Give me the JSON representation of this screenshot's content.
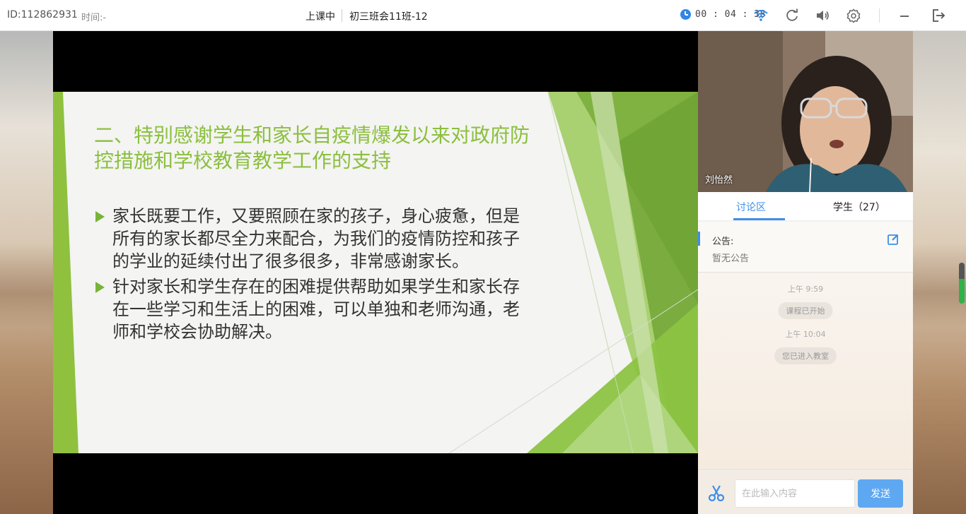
{
  "topbar": {
    "id_label": "ID:112862931",
    "time_label": "时间:-",
    "status": "上课中",
    "class_name": "初三班会11班-12",
    "timer": "00 : 04 : 38",
    "icons": [
      "clock-icon",
      "wifi-icon",
      "refresh-icon",
      "volume-icon",
      "settings-icon",
      "minimize-icon",
      "exit-icon"
    ]
  },
  "slide": {
    "title": "二、特别感谢学生和家长自疫情爆发以来对政府防控措施和学校教育教学工作的支持",
    "bullets": [
      "家长既要工作，又要照顾在家的孩子，身心疲惫，但是所有的家长都尽全力来配合，为我们的疫情防控和孩子的学业的延续付出了很多很多，非常感谢家长。",
      "针对家长和学生存在的困难提供帮助如果学生和家长存在一些学习和生活上的困难，可以单独和老师沟通，老师和学校会协助解决。"
    ],
    "colors": {
      "title": "#8bbf3f",
      "accent": "#79b33a"
    }
  },
  "camera": {
    "teacher_name": "刘怡然"
  },
  "tabs": {
    "discuss": "讨论区",
    "students": "学生（27）"
  },
  "notice": {
    "title": "公告:",
    "body": "暂无公告"
  },
  "chat": {
    "messages": [
      {
        "time": "上午 9:59",
        "text": "课程已开始"
      },
      {
        "time": "上午 10:04",
        "text": "您已进入教室"
      }
    ]
  },
  "input": {
    "placeholder": "在此输入内容",
    "send_label": "发送"
  },
  "accent_color": "#3d8ee8"
}
